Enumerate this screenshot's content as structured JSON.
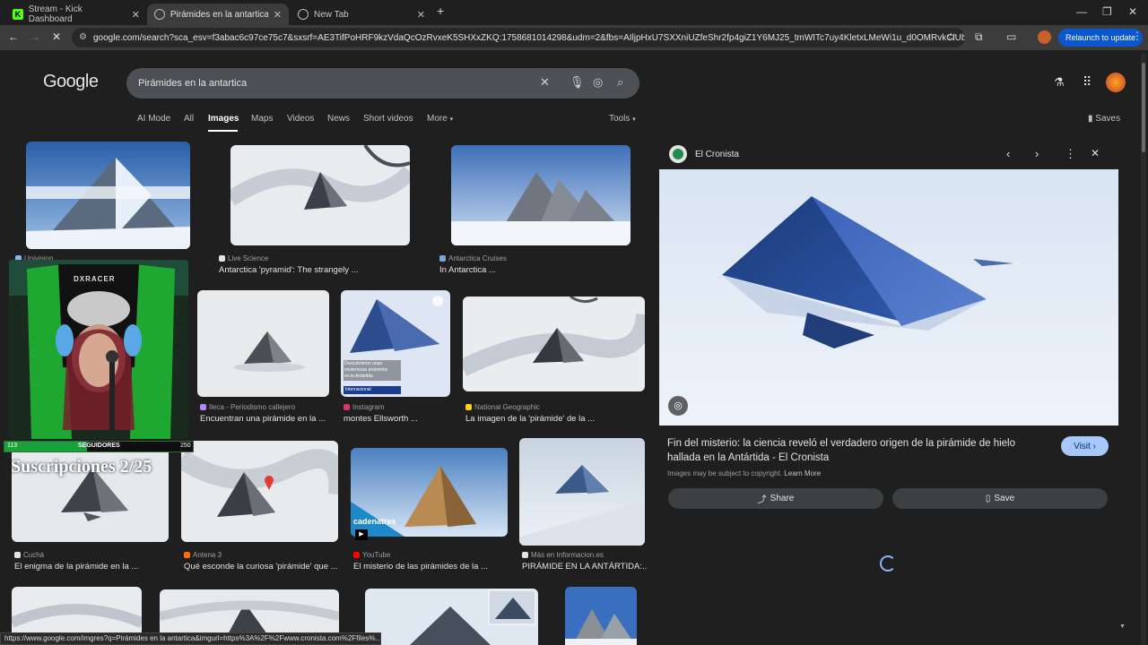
{
  "browser": {
    "tabs": [
      {
        "title": "Stream - Kick Dashboard",
        "active": false
      },
      {
        "title": "Pirámides en la antartica - Goo",
        "active": true
      },
      {
        "title": "New Tab",
        "active": false
      }
    ],
    "url": "google.com/search?sca_esv=f3abac6c97ce75c7&sxsrf=AE3TifPoHRF9kzVdaQcOzRvxeK5SHXxZKQ:1758681014298&udm=2&fbs=AIljpHxU7SXXniUZfeShr2fp4giZ1Y6MJ25_tmWITc7uy4KletxLMeWi1u_d0OMRvkClUba76WL62NDK...",
    "relaunch_label": "Relaunch to update",
    "status_url": "https://www.google.com/imgres?q=Pirámides en la antartica&imgurl=https%3A%2F%2Fwww.cronista.com%2Ffiles%..."
  },
  "google": {
    "logo": "Google",
    "query": "Pirámides en la antartica",
    "nav": [
      "AI Mode",
      "All",
      "Images",
      "Maps",
      "Videos",
      "News",
      "Short videos",
      "More"
    ],
    "tools": "Tools",
    "saves": "Saves"
  },
  "results": [
    {
      "source": "Univision",
      "caption": ""
    },
    {
      "source": "Live Science",
      "caption": "Antarctica 'pyramid': The strangely ..."
    },
    {
      "source": "Antarctica Cruises",
      "caption": "In Antarctica ..."
    },
    {
      "source": "Ileca - Periodismo callejero",
      "caption": "Encuentran una pirámide en la ..."
    },
    {
      "source": "Instagram",
      "caption": "montes Ellsworth ..."
    },
    {
      "source": "National Geographic",
      "caption": "La imagen de la 'pirámide' de la ..."
    },
    {
      "source": "Cuchá",
      "caption": "El enigma de la pirámide en la ..."
    },
    {
      "source": "Antena 3",
      "caption": "Qué esconde la curiosa 'pirámide' que ..."
    },
    {
      "source": "YouTube",
      "caption": "El misterio de las pirámides de la ..."
    },
    {
      "source": "Más en Informacion.es",
      "caption": "PIRÁMIDE EN LA ANTÁRTIDA:..."
    }
  ],
  "instagram_overlay": [
    "Descubrieron unas",
    "misteriosas pirámides",
    "en la Antártida"
  ],
  "instagram_tag": "Internacional",
  "youtube_logo": "cadenatres",
  "overlay": {
    "followers_label": "SEGUIDORES",
    "followers_left": "113",
    "followers_right": "250",
    "subs_text": "Suscripciones 2/25",
    "chair_brand": "DXRACER"
  },
  "preview": {
    "site": "El Cronista",
    "title": "Fin del misterio: la ciencia reveló el verdadero origen de la pirámide de hielo hallada en la Antártida - El Cronista",
    "visit": "Visit",
    "copyright": "Images may be subject to copyright.",
    "learn_more": "Learn More",
    "share": "Share",
    "save": "Save"
  },
  "colors": {
    "accent": "#a8c7fa",
    "bg": "#1f1f1f",
    "chip": "#3c4043"
  }
}
